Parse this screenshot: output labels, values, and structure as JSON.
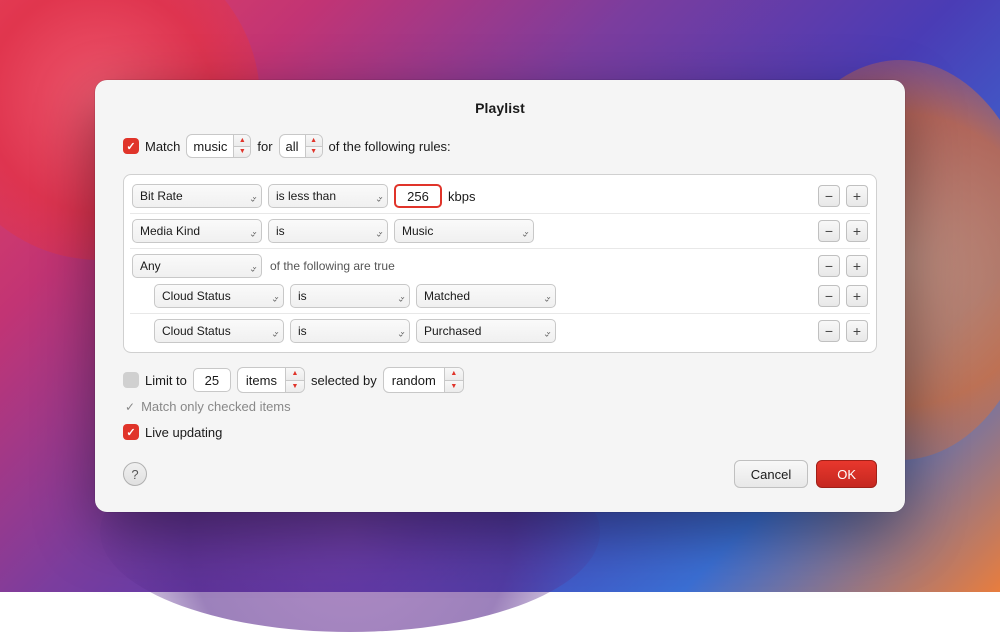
{
  "background": {
    "gradient": "linear-gradient"
  },
  "dialog": {
    "title": "Playlist",
    "match_label": "Match",
    "match_checkbox_checked": true,
    "for_label": "for",
    "of_following_label": "of the following rules:",
    "music_value": "music",
    "all_value": "all",
    "rules": [
      {
        "field": "Bit Rate",
        "condition": "is less than",
        "value": "256",
        "unit": "kbps",
        "type": "number"
      },
      {
        "field": "Media Kind",
        "condition": "is",
        "value": "Music",
        "type": "select"
      },
      {
        "field": "Any",
        "condition_text": "of the following are true",
        "type": "group"
      }
    ],
    "nested_rules": [
      {
        "field": "Cloud Status",
        "condition": "is",
        "value": "Matched",
        "type": "select"
      },
      {
        "field": "Cloud Status",
        "condition": "is",
        "value": "Purchased",
        "type": "select"
      }
    ],
    "limit": {
      "label": "Limit to",
      "enabled": false,
      "value": "25",
      "unit": "items",
      "selected_by_label": "selected by",
      "selected_by_value": "random"
    },
    "match_only": {
      "label": "Match only checked items",
      "enabled": false
    },
    "live_updating": {
      "label": "Live updating",
      "enabled": true
    },
    "buttons": {
      "help": "?",
      "cancel": "Cancel",
      "ok": "OK"
    }
  }
}
